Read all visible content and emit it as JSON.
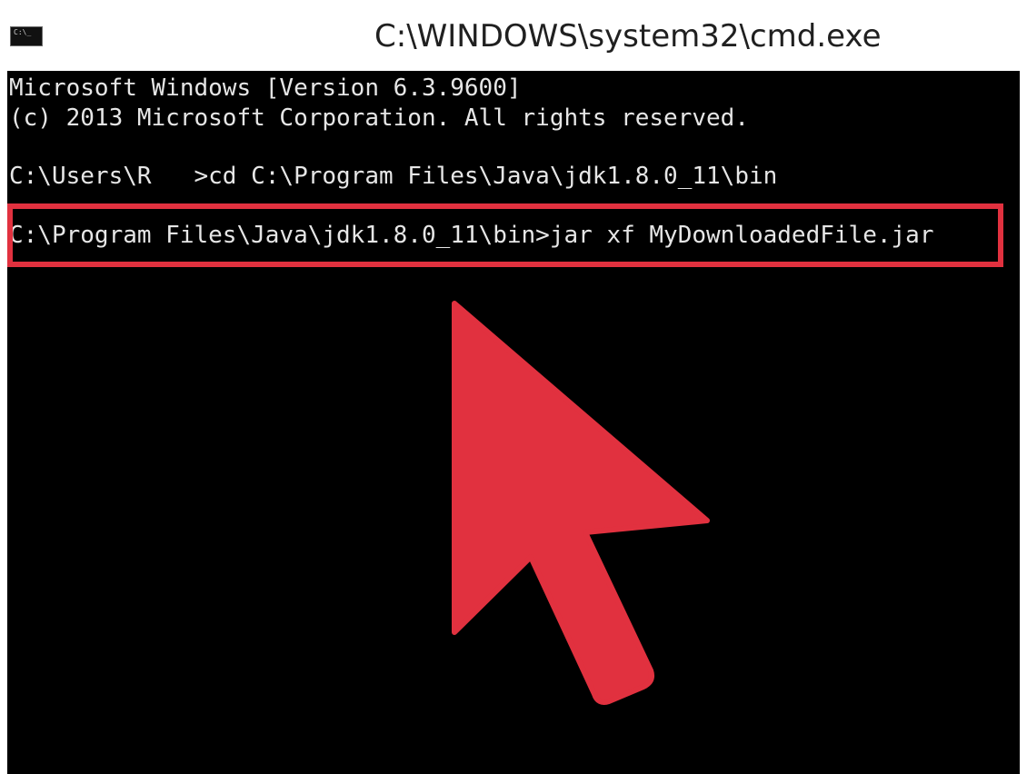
{
  "window": {
    "title": "C:\\WINDOWS\\system32\\cmd.exe",
    "icon": "command-prompt-icon",
    "icon_glyph": "C:\\_"
  },
  "console": {
    "lines": [
      "Microsoft Windows [Version 6.3.9600]",
      "(c) 2013 Microsoft Corporation. All rights reserved.",
      "C:\\Users\\R   >cd C:\\Program Files\\Java\\jdk1.8.0_11\\bin",
      "C:\\Program Files\\Java\\jdk1.8.0_11\\bin>jar xf MyDownloadedFile.jar"
    ]
  },
  "annotation": {
    "highlight_color": "#e1313f",
    "pointer_color": "#e1313f",
    "pointer_icon": "arrow-pointer-icon"
  },
  "colors": {
    "console_background": "#000000",
    "console_text": "#e6e6e6",
    "titlebar_background": "#ffffff"
  }
}
